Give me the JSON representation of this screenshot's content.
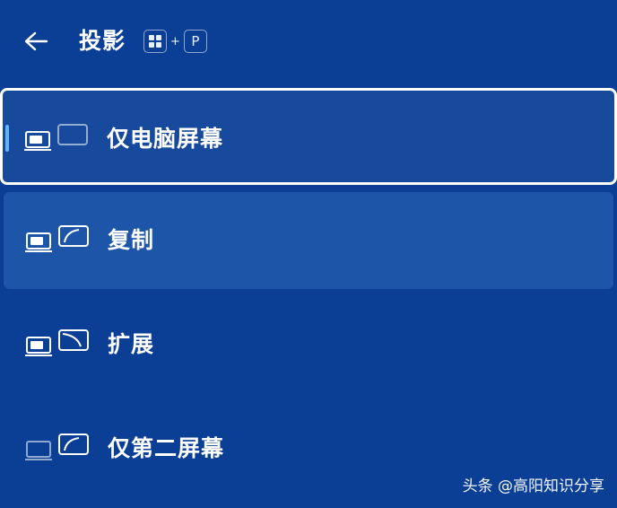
{
  "header": {
    "title": "投影",
    "shortcut": {
      "win_key_icon": "windows-logo-icon",
      "plus": "+",
      "letter_key": "P"
    },
    "back_icon": "arrow-left-icon"
  },
  "options": [
    {
      "label": "仅电脑屏幕",
      "icon": "pc-screen-only-icon",
      "state": "selected"
    },
    {
      "label": "复制",
      "icon": "duplicate-icon",
      "state": "hover"
    },
    {
      "label": "扩展",
      "icon": "extend-icon",
      "state": "normal"
    },
    {
      "label": "仅第二屏幕",
      "icon": "second-screen-only-icon",
      "state": "normal"
    }
  ],
  "watermark": "头条 @高阳知识分享",
  "colors": {
    "background": "#0b3f96",
    "selected_bg": "#174a9c",
    "hover_bg": "#1d56a8",
    "indicator": "#63b3ff",
    "text": "#ffffff"
  }
}
